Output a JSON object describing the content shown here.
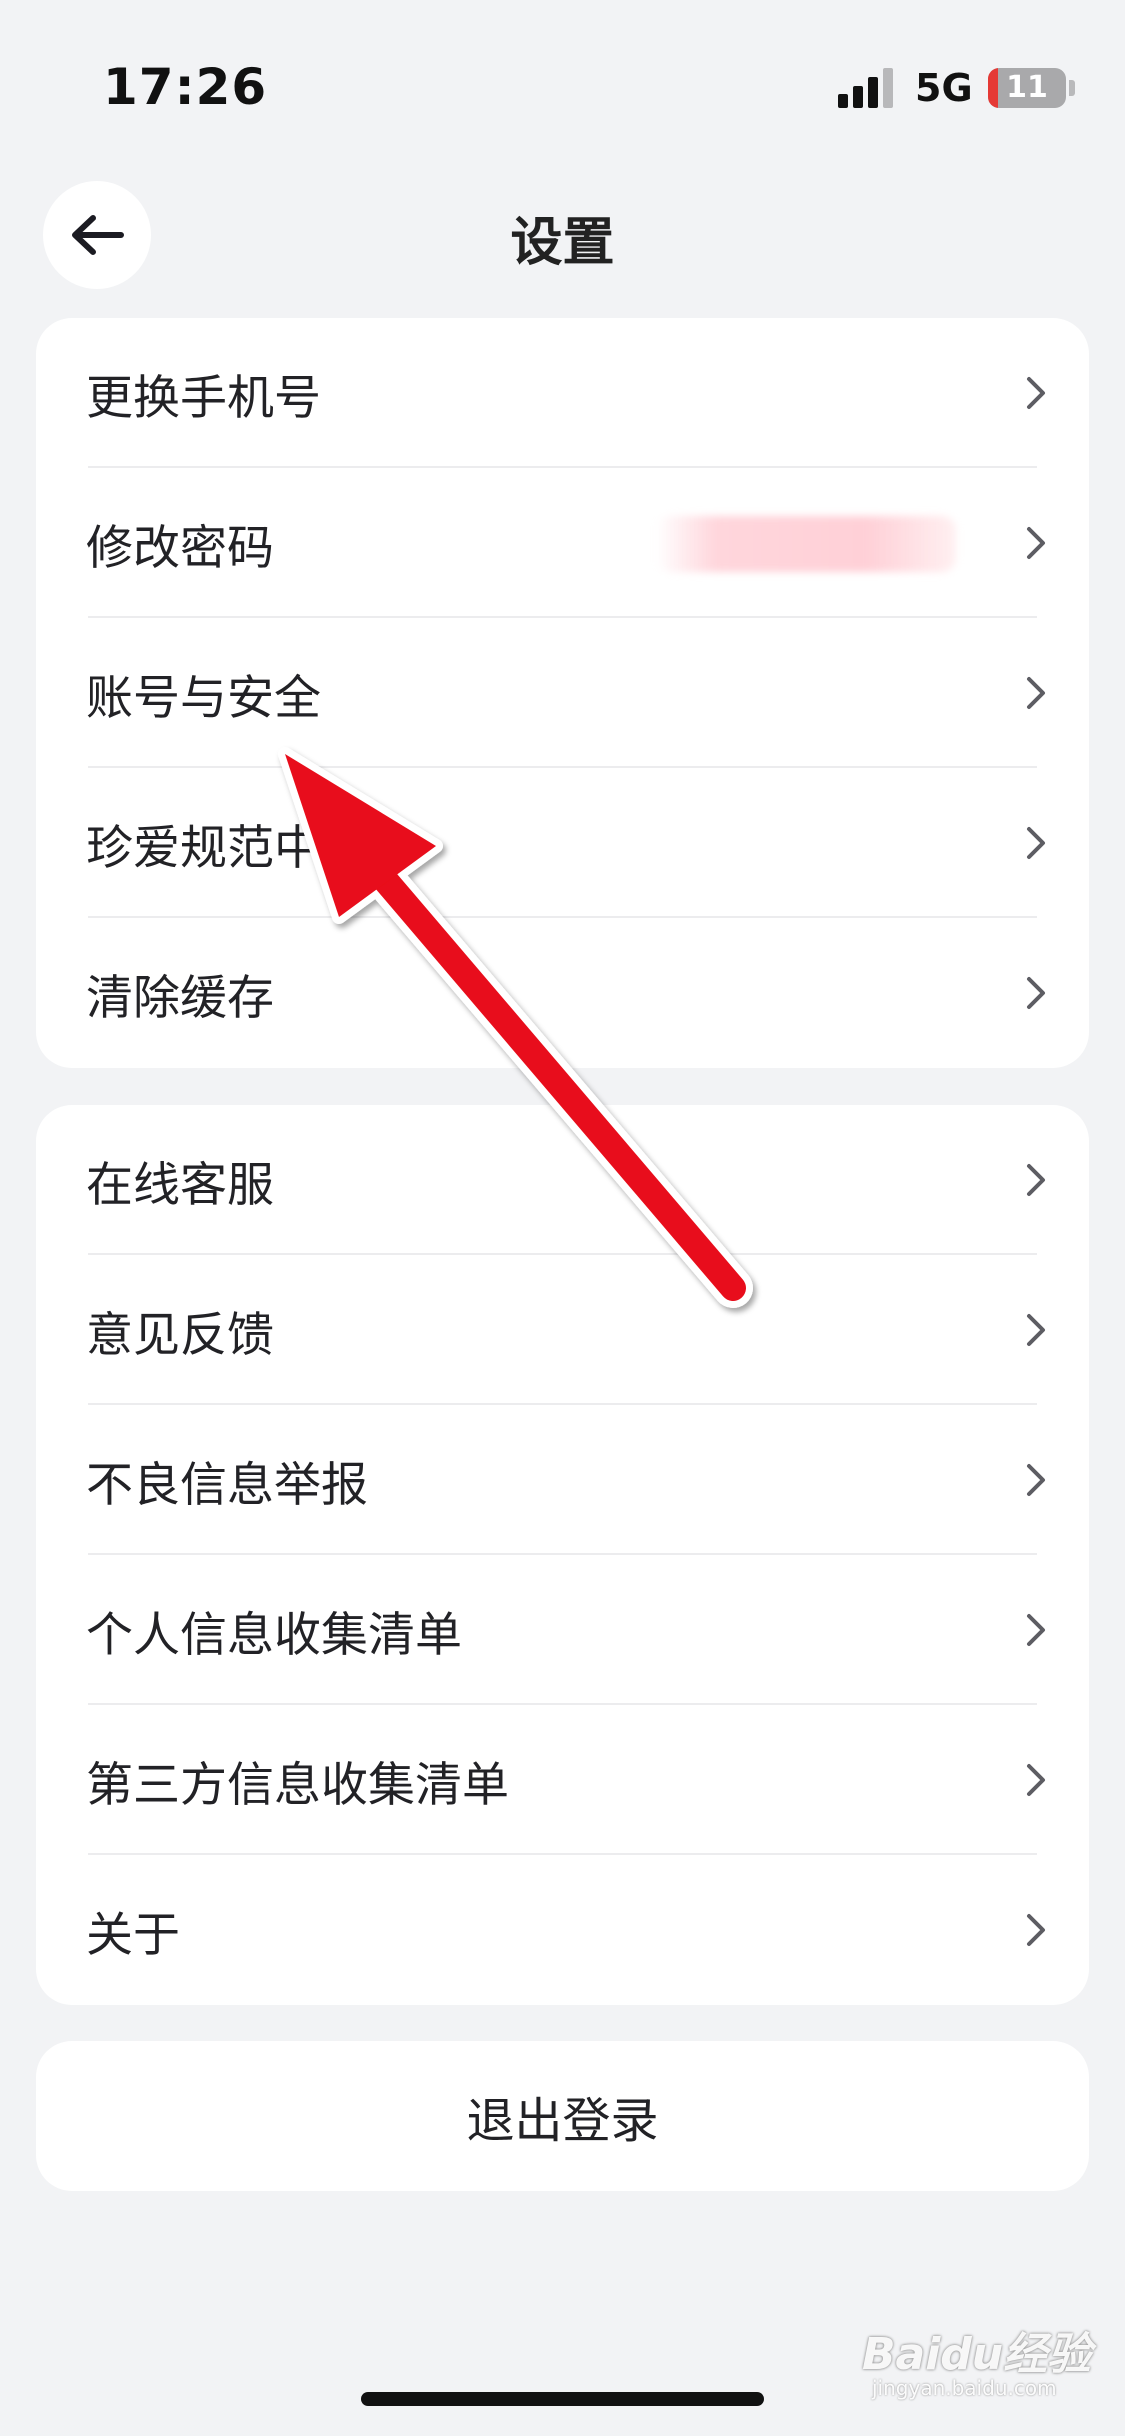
{
  "status_bar": {
    "time": "17:26",
    "network": "5G",
    "battery": "11"
  },
  "header": {
    "title": "设置"
  },
  "group1": {
    "items": [
      {
        "label": "更换手机号"
      },
      {
        "label": "修改密码"
      },
      {
        "label": "账号与安全"
      },
      {
        "label": "珍爱规范中"
      },
      {
        "label": "清除缓存"
      }
    ]
  },
  "group2": {
    "items": [
      {
        "label": "在线客服"
      },
      {
        "label": "意见反馈"
      },
      {
        "label": "不良信息举报"
      },
      {
        "label": "个人信息收集清单"
      },
      {
        "label": "第三方信息收集清单"
      },
      {
        "label": "关于"
      }
    ]
  },
  "logout": {
    "label": "退出登录"
  },
  "watermark": {
    "text": "Baidu经验",
    "sub": "jingyan.baidu.com"
  },
  "colors": {
    "background": "#f2f3f5",
    "card": "#ffffff",
    "annotation_arrow": "#e8101a",
    "battery_low": "#e53935"
  }
}
